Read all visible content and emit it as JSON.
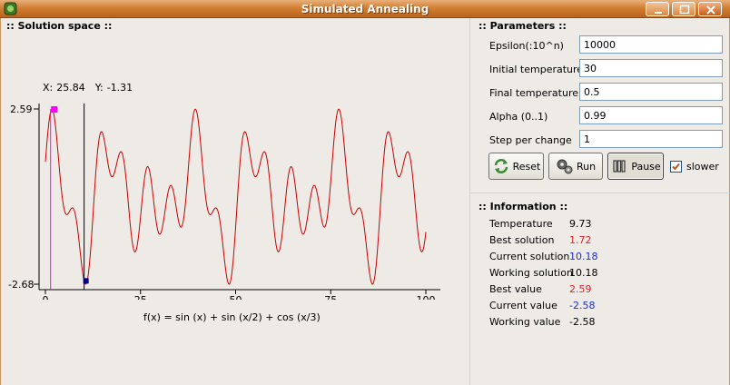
{
  "window": {
    "title": "Simulated Annealing"
  },
  "solution_space": {
    "title": ":: Solution space ::",
    "coords": {
      "x_label": "X:",
      "x_value": "25.84",
      "y_label": "Y:",
      "y_value": "-1.31"
    },
    "y_tick_top": "2.59",
    "y_tick_bottom": "-2.68",
    "x_ticks": [
      "0",
      "25",
      "50",
      "75",
      "100"
    ],
    "function_label": "f(x) = sin (x) + sin (x/2) + cos (x/3)"
  },
  "parameters": {
    "title": ":: Parameters ::",
    "fields": [
      {
        "label": "Epsilon(:10^n)",
        "value": "10000"
      },
      {
        "label": "Initial temperature",
        "value": "30"
      },
      {
        "label": "Final temperature",
        "value": "0.5"
      },
      {
        "label": "Alpha (0..1)",
        "value": "0.99"
      },
      {
        "label": "Step per change",
        "value": "1"
      }
    ],
    "buttons": {
      "reset": "Reset",
      "run": "Run",
      "pause": "Pause"
    },
    "slower_label": "slower",
    "slower_checked": true
  },
  "information": {
    "title": ":: Information ::",
    "rows": [
      {
        "label": "Temperature",
        "value": "9.73",
        "color": "#000000"
      },
      {
        "label": "Best solution",
        "value": "1.72",
        "color": "#e0202a"
      },
      {
        "label": "Current solution",
        "value": "10.18",
        "color": "#1a2ed8"
      },
      {
        "label": "Working solution",
        "value": "10.18",
        "color": "#000000"
      },
      {
        "label": "Best value",
        "value": "2.59",
        "color": "#e0202a"
      },
      {
        "label": "Current value",
        "value": "-2.58",
        "color": "#1a2ed8"
      },
      {
        "label": "Working value",
        "value": "-2.58",
        "color": "#000000"
      }
    ]
  },
  "chart_data": {
    "type": "line",
    "function": "sin(x) + sin(x/2) + cos(x/3)",
    "xlim": [
      0,
      100
    ],
    "ylim": [
      -2.68,
      2.59
    ],
    "x_ticks": [
      0,
      25,
      50,
      75,
      100
    ],
    "best_solution": {
      "x": 1.72,
      "y": 2.59
    },
    "current_solution": {
      "x": 10.18,
      "y": -2.58
    },
    "curve_color": "#cc0000",
    "best_marker_color": "#ff00ff",
    "current_marker_color": "#000080"
  }
}
